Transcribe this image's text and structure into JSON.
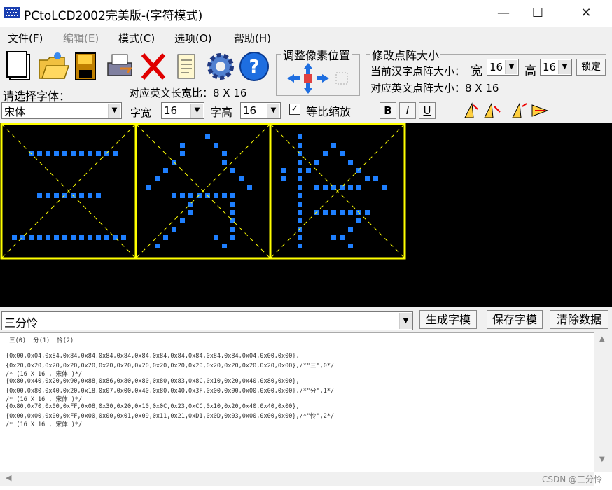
{
  "window": {
    "title": "PCtoLCD2002完美版-(字符模式)",
    "minimize": "—",
    "maximize": "☐",
    "close": "✕"
  },
  "menu": [
    "文件(F)",
    "编辑(E)",
    "模式(C)",
    "选项(O)",
    "帮助(H)"
  ],
  "toolbar_icons": [
    "new-icon",
    "open-icon",
    "save-icon",
    "print-icon",
    "delete-icon",
    "notes-icon",
    "settings-gear-icon",
    "help-icon"
  ],
  "adjust": {
    "label": "调整像素位置"
  },
  "matrix": {
    "label": "修改点阵大小",
    "current_label": "当前汉字点阵大小：",
    "width_label": "宽",
    "width_value": "16",
    "height_label": "高",
    "height_value": "16",
    "lock_label": "锁定",
    "english_size_label": "对应英文点阵大小：8 X 16"
  },
  "font": {
    "select_label": "请选择字体：",
    "english_ratio_label": "对应英文长宽比：8 X 16",
    "font_value": "宋体",
    "char_width_label": "字宽",
    "char_width_value": "16",
    "char_height_label": "字高",
    "char_height_value": "16",
    "proportional_label": "等比缩放",
    "bold": "B",
    "italic": "I",
    "underline": "U"
  },
  "accent_colors": {
    "grid_border": "#ffff00",
    "pixel": "#1e7fff"
  },
  "glyphs": [
    [
      "0000000000000000",
      "0000000000000000",
      "0000000000000000",
      "0001111111111100",
      "0000000000000000",
      "0000000000000000",
      "0000000000000000",
      "0000000000000000",
      "0000111111110000",
      "0000000000000000",
      "0000000000000000",
      "0000000000000000",
      "0000000000000000",
      "0111111111111110",
      "0000000000000000",
      "0000000000000000"
    ],
    [
      "0000000000000000",
      "0000000010000000",
      "0000010001000000",
      "0000010000100000",
      "0000100000100000",
      "0001000000010000",
      "0010000000001000",
      "0100000000000100",
      "0000111111110000",
      "0000001000010000",
      "0000001000010000",
      "0000010000010000",
      "0000100000010000",
      "0001000001010000",
      "0010000000100000",
      "0000000000000000"
    ],
    [
      "0000000000000000",
      "0001000000000000",
      "0001000100000000",
      "0001001010000000",
      "0001010001000000",
      "0101100000100000",
      "0101000000011000",
      "0001011111100100",
      "0001000000000000",
      "0001000000000000",
      "0001011111110000",
      "0001000000100000",
      "0001000001000000",
      "0001000110000000",
      "0001000001000000",
      "0000000000000000"
    ]
  ],
  "input": {
    "text": "三分怜",
    "generate": "生成字模",
    "save": "保存字模",
    "clear": "清除数据"
  },
  "output_lines": [
    " 三(0)  分(1)  怜(2)",
    "",
    "{0x00,0x04,0x84,0x84,0x84,0x84,0x84,0x84,0x84,0x84,0x84,0x84,0x84,0x04,0x00,0x00},",
    "{0x20,0x20,0x20,0x20,0x20,0x20,0x20,0x20,0x20,0x20,0x20,0x20,0x20,0x20,0x20,0x00},/*\"三\",0*/",
    "/* (16 X 16 , 宋体 )*/",
    "{0x80,0x40,0x20,0x90,0x88,0x86,0x80,0x80,0x80,0x83,0x8C,0x10,0x20,0x40,0x80,0x00},",
    "{0x00,0x80,0x40,0x20,0x18,0x07,0x00,0x40,0x80,0x40,0x3F,0x00,0x00,0x00,0x00,0x00},/*\"分\",1*/",
    "/* (16 X 16 , 宋体 )*/",
    "{0x80,0x70,0x00,0xFF,0x08,0x30,0x20,0x10,0x0C,0x23,0xCC,0x10,0x20,0x40,0x40,0x00},",
    "{0x00,0x00,0x00,0xFF,0x00,0x00,0x01,0x09,0x11,0x21,0xD1,0x0D,0x03,0x00,0x00,0x00},/*\"怜\",2*/",
    "/* (16 X 16 , 宋体 )*/"
  ],
  "watermark": "CSDN @三分怜"
}
